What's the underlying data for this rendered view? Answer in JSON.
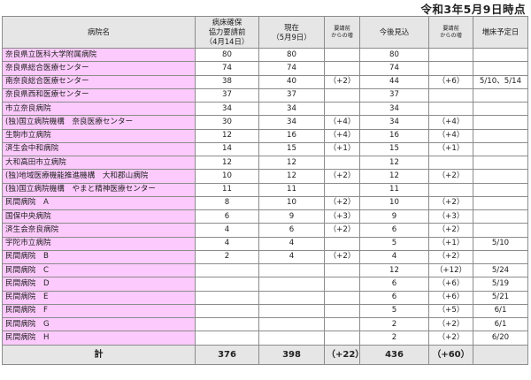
{
  "as_of": "令和3年5月9日時点",
  "headers": {
    "hospital": "病院名",
    "requested_l1": "病床確保",
    "requested_l2": "協力要請前",
    "requested_l3": "（4月14日）",
    "current_l1": "現在",
    "current_l2": "（5月9日）",
    "current_inc_l1": "要請前",
    "current_inc_l2": "からの増",
    "outlook": "今後見込",
    "outlook_inc_l1": "要請前",
    "outlook_inc_l2": "からの増",
    "plan_date": "増床予定日"
  },
  "rows": [
    {
      "name": "奈良県立医科大学附属病院",
      "before": "80",
      "current": "80",
      "current_inc": "",
      "outlook": "80",
      "outlook_inc": "",
      "date": ""
    },
    {
      "name": "奈良県総合医療センター",
      "before": "74",
      "current": "74",
      "current_inc": "",
      "outlook": "74",
      "outlook_inc": "",
      "date": ""
    },
    {
      "name": "南奈良総合医療センター",
      "before": "38",
      "current": "40",
      "current_inc": "（+2）",
      "outlook": "44",
      "outlook_inc": "（+6）",
      "date": "5/10、5/14"
    },
    {
      "name": "奈良県西和医療センター",
      "before": "37",
      "current": "37",
      "current_inc": "",
      "outlook": "37",
      "outlook_inc": "",
      "date": ""
    },
    {
      "name": "市立奈良病院",
      "before": "34",
      "current": "34",
      "current_inc": "",
      "outlook": "34",
      "outlook_inc": "",
      "date": ""
    },
    {
      "name": "(独)国立病院機構　奈良医療センター",
      "before": "30",
      "current": "34",
      "current_inc": "（+4）",
      "outlook": "34",
      "outlook_inc": "（+4）",
      "date": ""
    },
    {
      "name": "生駒市立病院",
      "before": "12",
      "current": "16",
      "current_inc": "（+4）",
      "outlook": "16",
      "outlook_inc": "（+4）",
      "date": ""
    },
    {
      "name": "済生会中和病院",
      "before": "14",
      "current": "15",
      "current_inc": "（+1）",
      "outlook": "15",
      "outlook_inc": "（+1）",
      "date": ""
    },
    {
      "name": "大和高田市立病院",
      "before": "12",
      "current": "12",
      "current_inc": "",
      "outlook": "12",
      "outlook_inc": "",
      "date": ""
    },
    {
      "name": "(独)地域医療機能推進機構　大和郡山病院",
      "before": "10",
      "current": "12",
      "current_inc": "（+2）",
      "outlook": "12",
      "outlook_inc": "（+2）",
      "date": ""
    },
    {
      "name": "(独)国立病院機構　やまと精神医療センター",
      "before": "11",
      "current": "11",
      "current_inc": "",
      "outlook": "11",
      "outlook_inc": "",
      "date": ""
    },
    {
      "name": "民間病院　A",
      "before": "8",
      "current": "10",
      "current_inc": "（+2）",
      "outlook": "10",
      "outlook_inc": "（+2）",
      "date": ""
    },
    {
      "name": "国保中央病院",
      "before": "6",
      "current": "9",
      "current_inc": "（+3）",
      "outlook": "9",
      "outlook_inc": "（+3）",
      "date": ""
    },
    {
      "name": "済生会奈良病院",
      "before": "4",
      "current": "6",
      "current_inc": "（+2）",
      "outlook": "6",
      "outlook_inc": "（+2）",
      "date": ""
    },
    {
      "name": "宇陀市立病院",
      "before": "4",
      "current": "4",
      "current_inc": "",
      "outlook": "5",
      "outlook_inc": "（+1）",
      "date": "5/10"
    },
    {
      "name": "民間病院　B",
      "before": "2",
      "current": "4",
      "current_inc": "（+2）",
      "outlook": "4",
      "outlook_inc": "（+2）",
      "date": ""
    },
    {
      "name": "民間病院　C",
      "before": "",
      "current": "",
      "current_inc": "",
      "outlook": "12",
      "outlook_inc": "（+12）",
      "date": "5/24"
    },
    {
      "name": "民間病院　D",
      "before": "",
      "current": "",
      "current_inc": "",
      "outlook": "6",
      "outlook_inc": "（+6）",
      "date": "5/19"
    },
    {
      "name": "民間病院　E",
      "before": "",
      "current": "",
      "current_inc": "",
      "outlook": "6",
      "outlook_inc": "（+6）",
      "date": "5/21"
    },
    {
      "name": "民間病院　F",
      "before": "",
      "current": "",
      "current_inc": "",
      "outlook": "5",
      "outlook_inc": "（+5）",
      "date": "6/1"
    },
    {
      "name": "民間病院　G",
      "before": "",
      "current": "",
      "current_inc": "",
      "outlook": "2",
      "outlook_inc": "（+2）",
      "date": "6/1"
    },
    {
      "name": "民間病院　H",
      "before": "",
      "current": "",
      "current_inc": "",
      "outlook": "2",
      "outlook_inc": "（+2）",
      "date": "6/20"
    }
  ],
  "total": {
    "label": "計",
    "before": "376",
    "current": "398",
    "current_inc": "（+22）",
    "outlook": "436",
    "outlook_inc": "（+60）",
    "date": ""
  }
}
